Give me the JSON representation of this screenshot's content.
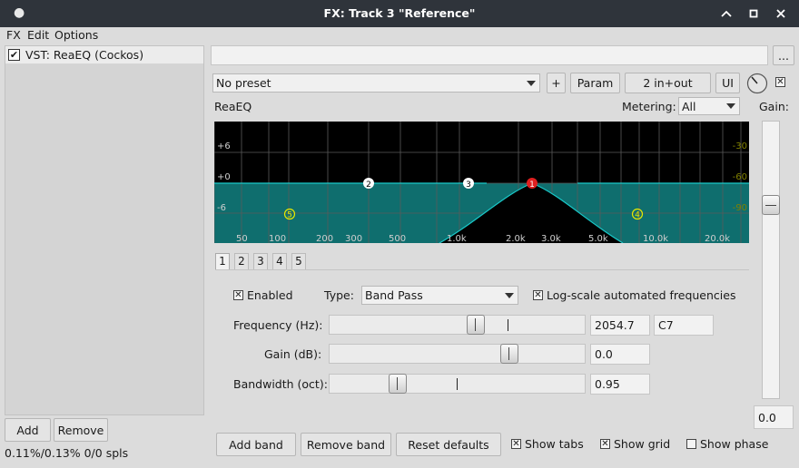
{
  "window": {
    "title": "FX: Track 3 \"Reference\"",
    "minimize_glyph": "⌄",
    "close_glyph": "×"
  },
  "menu": {
    "fx": "FX",
    "edit": "Edit",
    "options": "Options"
  },
  "fx_chain": {
    "items": [
      {
        "label": "VST: ReaEQ (Cockos)",
        "enabled": true
      }
    ],
    "add_label": "Add",
    "remove_label": "Remove",
    "status": "0.11%/0.13% 0/0 spls"
  },
  "plugin": {
    "name_field": "",
    "more_label": "...",
    "preset": "No preset",
    "plus_label": "+",
    "param_label": "Param",
    "io_label": "2 in+out",
    "ui_label": "UI",
    "bypass_glyph": "✕"
  },
  "eq": {
    "title": "ReaEQ",
    "metering_label": "Metering:",
    "metering_value": "All",
    "gain_label": "Gain:",
    "gain_value": "0.0",
    "db_labels_left": [
      "+6",
      "+0",
      "-6"
    ],
    "db_labels_right": [
      "-30",
      "-60",
      "-90"
    ],
    "freq_labels": [
      "50",
      "100",
      "200",
      "300",
      "500",
      "1.0k",
      "2.0k",
      "3.0k",
      "5.0k",
      "10.0k",
      "20.0k"
    ],
    "bands": [
      {
        "label": "1",
        "color": "#e02020"
      },
      {
        "label": "2",
        "color": "#ffffff"
      },
      {
        "label": "3",
        "color": "#ffffff"
      },
      {
        "label": "4",
        "color": "#e8e800"
      },
      {
        "label": "5",
        "color": "#e8e800"
      }
    ],
    "tabs": [
      "1",
      "2",
      "3",
      "4",
      "5"
    ],
    "selected_tab": "1",
    "colors": {
      "background": "#000000",
      "fill": "#0f6e6e",
      "curve": "#19c9c9",
      "grid": "#5a5a5a"
    }
  },
  "band_settings": {
    "enabled_label": "Enabled",
    "enabled_checked": true,
    "type_label": "Type:",
    "type_value": "Band Pass",
    "logscale_label": "Log-scale automated frequencies",
    "logscale_checked": true,
    "frequency_label": "Frequency (Hz):",
    "frequency_value": "2054.7",
    "frequency_note": "C7",
    "frequency_position": 0.58,
    "gain_label": "Gain (dB):",
    "gain_value": "0.0",
    "gain_position": 0.72,
    "bandwidth_label": "Bandwidth (oct):",
    "bandwidth_value": "0.95",
    "bandwidth_position": 0.25
  },
  "footer": {
    "add_band": "Add band",
    "remove_band": "Remove band",
    "reset_defaults": "Reset defaults",
    "show_tabs_label": "Show tabs",
    "show_tabs_checked": true,
    "show_grid_label": "Show grid",
    "show_grid_checked": true,
    "show_phase_label": "Show phase",
    "show_phase_checked": false
  }
}
